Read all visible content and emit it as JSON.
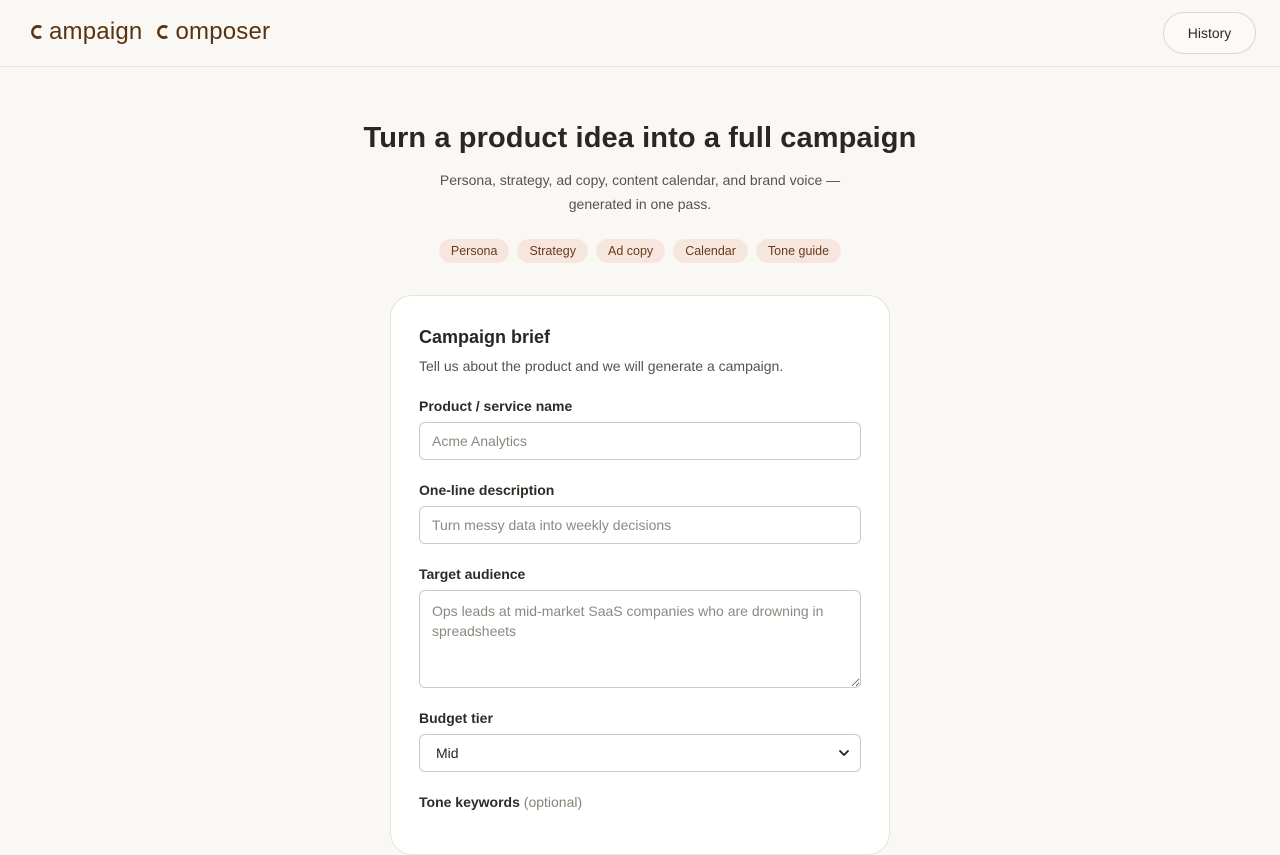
{
  "header": {
    "logo_word1": "ampaign",
    "logo_word2": "omposer",
    "history_label": "History"
  },
  "hero": {
    "title": "Turn a product idea into a full campaign",
    "subtitle": "Persona, strategy, ad copy, content calendar, and brand voice — generated in one pass.",
    "chips": [
      "Persona",
      "Strategy",
      "Ad copy",
      "Calendar",
      "Tone guide"
    ]
  },
  "form": {
    "title": "Campaign brief",
    "subtitle": "Tell us about the product and we will generate a campaign.",
    "product": {
      "label": "Product / service name",
      "placeholder": "Acme Analytics",
      "value": ""
    },
    "description": {
      "label": "One-line description",
      "placeholder": "Turn messy data into weekly decisions",
      "value": ""
    },
    "audience": {
      "label": "Target audience",
      "placeholder": "Ops leads at mid-market SaaS companies who are drowning in spreadsheets",
      "value": ""
    },
    "budget": {
      "label": "Budget tier",
      "selected": "Mid"
    },
    "tone": {
      "label": "Tone keywords",
      "optional": "(optional)"
    }
  },
  "colors": {
    "brand": "#5a3410",
    "chip_bg": "#f7e6dd",
    "background": "#faf8f5"
  },
  "icons": {
    "logo_mark": "c-arc-icon",
    "select_caret": "chevron-down-icon"
  }
}
